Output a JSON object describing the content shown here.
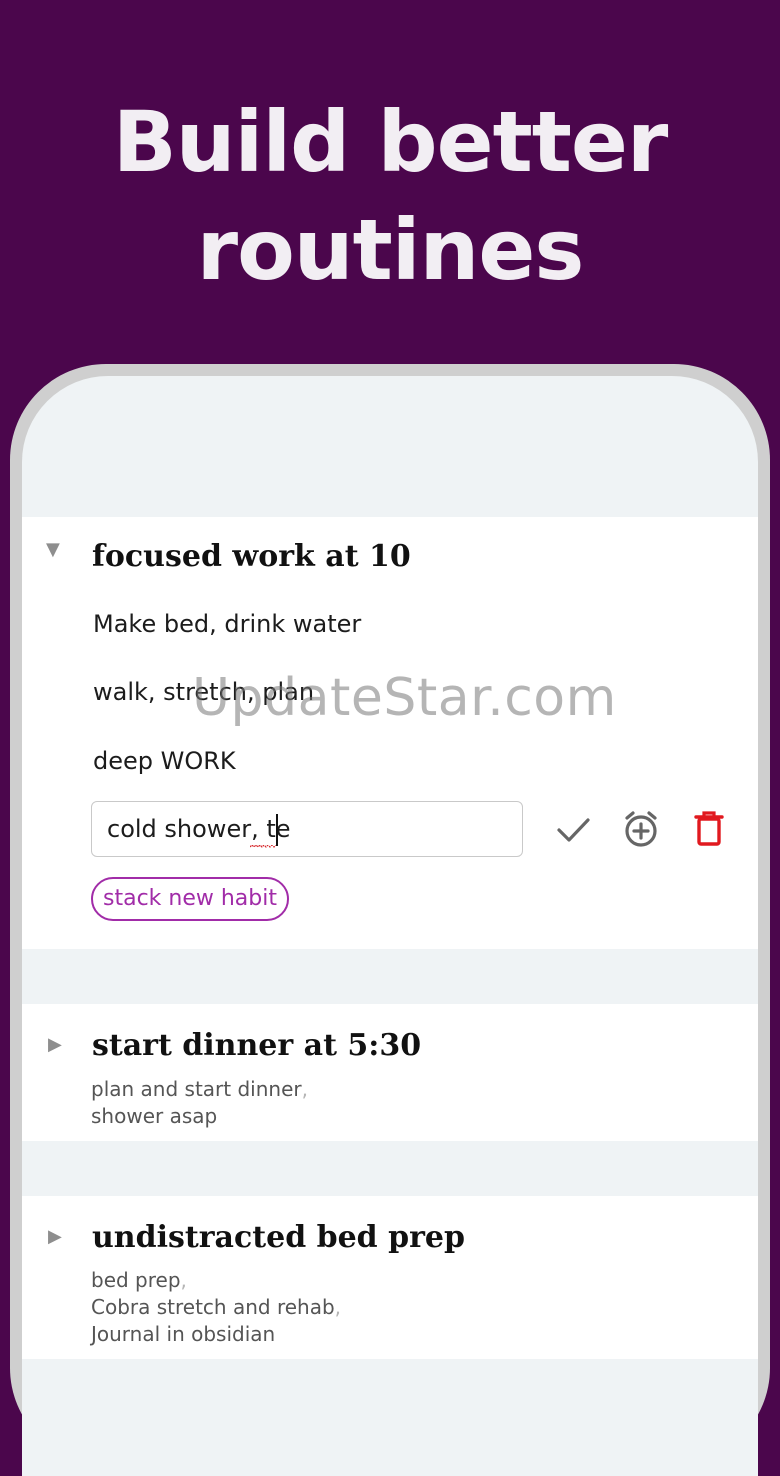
{
  "headline": {
    "line1": "Build better",
    "line2": "routines"
  },
  "routines": [
    {
      "title": "focused work at 10",
      "expanded": true,
      "habits": [
        "Make bed, drink water",
        "walk, stretch, plan",
        "deep WORK"
      ],
      "new_habit_value": "cold shower, te",
      "stack_label": "stack new habit"
    },
    {
      "title": "start dinner at 5:30",
      "expanded": false,
      "summary": [
        "plan and start dinner",
        "shower asap"
      ]
    },
    {
      "title": "undistracted bed prep",
      "expanded": false,
      "summary": [
        "bed prep",
        "Cobra stretch and rehab",
        "Journal in obsidian"
      ]
    }
  ],
  "watermark": "UpdateStar.com",
  "colors": {
    "background": "#4b064c",
    "accent": "#a12ca8",
    "delete": "#e1191f",
    "icon_gray": "#666666"
  },
  "icons": [
    "caret-down-icon",
    "caret-right-icon",
    "check-icon",
    "alarm-add-icon",
    "trash-icon"
  ]
}
